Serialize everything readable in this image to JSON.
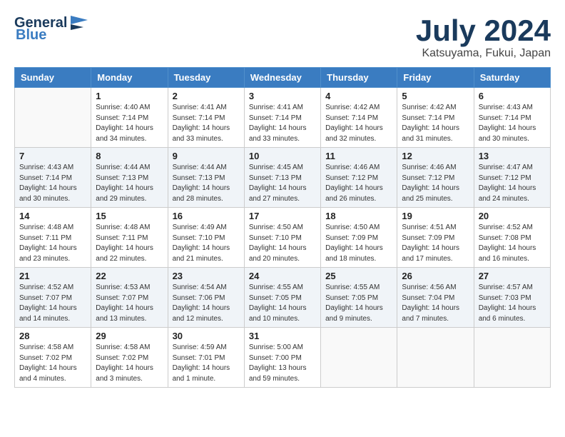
{
  "header": {
    "logo_general": "General",
    "logo_blue": "Blue",
    "month_title": "July 2024",
    "location": "Katsuyama, Fukui, Japan"
  },
  "columns": [
    "Sunday",
    "Monday",
    "Tuesday",
    "Wednesday",
    "Thursday",
    "Friday",
    "Saturday"
  ],
  "weeks": [
    {
      "shade": "white",
      "days": [
        {
          "num": "",
          "info": ""
        },
        {
          "num": "1",
          "info": "Sunrise: 4:40 AM\nSunset: 7:14 PM\nDaylight: 14 hours\nand 34 minutes."
        },
        {
          "num": "2",
          "info": "Sunrise: 4:41 AM\nSunset: 7:14 PM\nDaylight: 14 hours\nand 33 minutes."
        },
        {
          "num": "3",
          "info": "Sunrise: 4:41 AM\nSunset: 7:14 PM\nDaylight: 14 hours\nand 33 minutes."
        },
        {
          "num": "4",
          "info": "Sunrise: 4:42 AM\nSunset: 7:14 PM\nDaylight: 14 hours\nand 32 minutes."
        },
        {
          "num": "5",
          "info": "Sunrise: 4:42 AM\nSunset: 7:14 PM\nDaylight: 14 hours\nand 31 minutes."
        },
        {
          "num": "6",
          "info": "Sunrise: 4:43 AM\nSunset: 7:14 PM\nDaylight: 14 hours\nand 30 minutes."
        }
      ]
    },
    {
      "shade": "shade",
      "days": [
        {
          "num": "7",
          "info": "Sunrise: 4:43 AM\nSunset: 7:14 PM\nDaylight: 14 hours\nand 30 minutes."
        },
        {
          "num": "8",
          "info": "Sunrise: 4:44 AM\nSunset: 7:13 PM\nDaylight: 14 hours\nand 29 minutes."
        },
        {
          "num": "9",
          "info": "Sunrise: 4:44 AM\nSunset: 7:13 PM\nDaylight: 14 hours\nand 28 minutes."
        },
        {
          "num": "10",
          "info": "Sunrise: 4:45 AM\nSunset: 7:13 PM\nDaylight: 14 hours\nand 27 minutes."
        },
        {
          "num": "11",
          "info": "Sunrise: 4:46 AM\nSunset: 7:12 PM\nDaylight: 14 hours\nand 26 minutes."
        },
        {
          "num": "12",
          "info": "Sunrise: 4:46 AM\nSunset: 7:12 PM\nDaylight: 14 hours\nand 25 minutes."
        },
        {
          "num": "13",
          "info": "Sunrise: 4:47 AM\nSunset: 7:12 PM\nDaylight: 14 hours\nand 24 minutes."
        }
      ]
    },
    {
      "shade": "white",
      "days": [
        {
          "num": "14",
          "info": "Sunrise: 4:48 AM\nSunset: 7:11 PM\nDaylight: 14 hours\nand 23 minutes."
        },
        {
          "num": "15",
          "info": "Sunrise: 4:48 AM\nSunset: 7:11 PM\nDaylight: 14 hours\nand 22 minutes."
        },
        {
          "num": "16",
          "info": "Sunrise: 4:49 AM\nSunset: 7:10 PM\nDaylight: 14 hours\nand 21 minutes."
        },
        {
          "num": "17",
          "info": "Sunrise: 4:50 AM\nSunset: 7:10 PM\nDaylight: 14 hours\nand 20 minutes."
        },
        {
          "num": "18",
          "info": "Sunrise: 4:50 AM\nSunset: 7:09 PM\nDaylight: 14 hours\nand 18 minutes."
        },
        {
          "num": "19",
          "info": "Sunrise: 4:51 AM\nSunset: 7:09 PM\nDaylight: 14 hours\nand 17 minutes."
        },
        {
          "num": "20",
          "info": "Sunrise: 4:52 AM\nSunset: 7:08 PM\nDaylight: 14 hours\nand 16 minutes."
        }
      ]
    },
    {
      "shade": "shade",
      "days": [
        {
          "num": "21",
          "info": "Sunrise: 4:52 AM\nSunset: 7:07 PM\nDaylight: 14 hours\nand 14 minutes."
        },
        {
          "num": "22",
          "info": "Sunrise: 4:53 AM\nSunset: 7:07 PM\nDaylight: 14 hours\nand 13 minutes."
        },
        {
          "num": "23",
          "info": "Sunrise: 4:54 AM\nSunset: 7:06 PM\nDaylight: 14 hours\nand 12 minutes."
        },
        {
          "num": "24",
          "info": "Sunrise: 4:55 AM\nSunset: 7:05 PM\nDaylight: 14 hours\nand 10 minutes."
        },
        {
          "num": "25",
          "info": "Sunrise: 4:55 AM\nSunset: 7:05 PM\nDaylight: 14 hours\nand 9 minutes."
        },
        {
          "num": "26",
          "info": "Sunrise: 4:56 AM\nSunset: 7:04 PM\nDaylight: 14 hours\nand 7 minutes."
        },
        {
          "num": "27",
          "info": "Sunrise: 4:57 AM\nSunset: 7:03 PM\nDaylight: 14 hours\nand 6 minutes."
        }
      ]
    },
    {
      "shade": "white",
      "days": [
        {
          "num": "28",
          "info": "Sunrise: 4:58 AM\nSunset: 7:02 PM\nDaylight: 14 hours\nand 4 minutes."
        },
        {
          "num": "29",
          "info": "Sunrise: 4:58 AM\nSunset: 7:02 PM\nDaylight: 14 hours\nand 3 minutes."
        },
        {
          "num": "30",
          "info": "Sunrise: 4:59 AM\nSunset: 7:01 PM\nDaylight: 14 hours\nand 1 minute."
        },
        {
          "num": "31",
          "info": "Sunrise: 5:00 AM\nSunset: 7:00 PM\nDaylight: 13 hours\nand 59 minutes."
        },
        {
          "num": "",
          "info": ""
        },
        {
          "num": "",
          "info": ""
        },
        {
          "num": "",
          "info": ""
        }
      ]
    }
  ]
}
